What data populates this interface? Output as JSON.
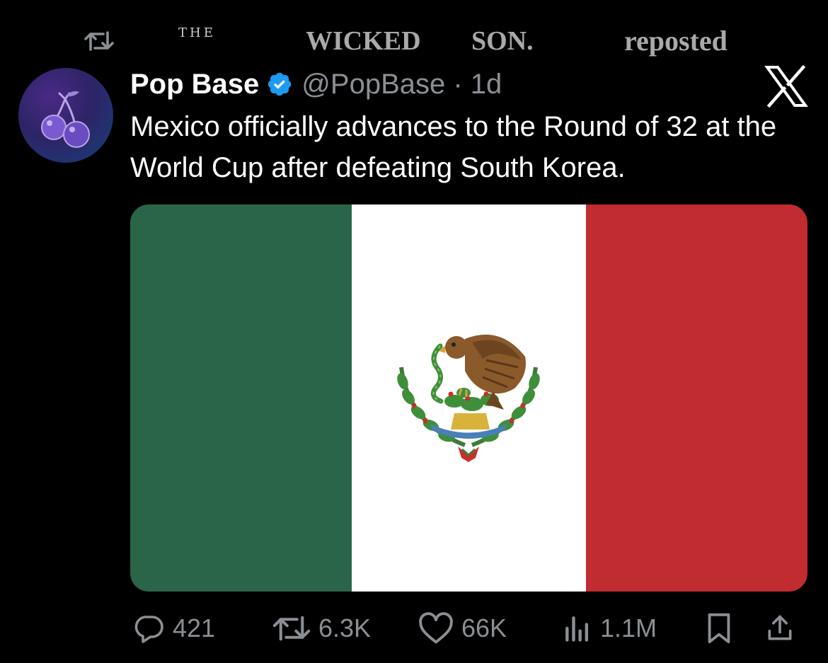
{
  "repost": {
    "watermark_the": "THE",
    "watermark_wicked": "WICKED",
    "watermark_son": "SON.",
    "label": "reposted"
  },
  "tweet": {
    "author_name": "Pop Base",
    "handle_time": "@PopBase · 1d",
    "text": "Mexico officially advances to the Round of 32 at the World Cup after defeating South Korea.",
    "image": "mexico-flag"
  },
  "actions": {
    "replies": "421",
    "reposts": "6.3K",
    "likes": "66K",
    "views": "1.1M"
  },
  "colors": {
    "background": "#000000",
    "muted_text": "#8b8f94",
    "verified_badge": "#1d9bf0",
    "flag_green": "#2a6548",
    "flag_white": "#ffffff",
    "flag_red": "#c12c30"
  },
  "icons": {
    "repost_header": "repost-icon",
    "verified": "verified-badge-icon",
    "platform": "x-logo-icon",
    "reply": "reply-icon",
    "repost": "repost-icon",
    "like": "heart-icon",
    "views": "views-icon",
    "bookmark": "bookmark-icon",
    "share": "share-icon"
  }
}
